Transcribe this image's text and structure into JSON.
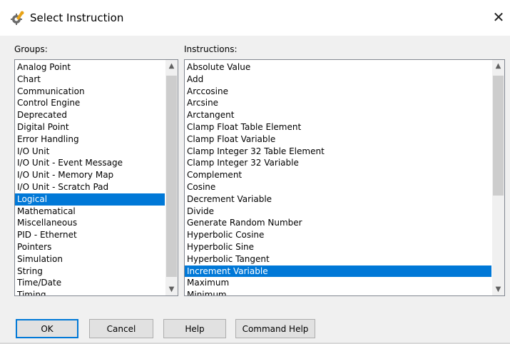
{
  "window": {
    "title": "Select Instruction",
    "close_glyph": "✕",
    "icon": "gear-wrench-icon"
  },
  "groups": {
    "label": "Groups:",
    "selected_index": 11,
    "items": [
      "Analog Point",
      "Chart",
      "Communication",
      "Control Engine",
      "Deprecated",
      "Digital Point",
      "Error Handling",
      "I/O Unit",
      "I/O Unit - Event Message",
      "I/O Unit - Memory Map",
      "I/O Unit - Scratch Pad",
      "Logical",
      "Mathematical",
      "Miscellaneous",
      "PID - Ethernet",
      "Pointers",
      "Simulation",
      "String",
      "Time/Date",
      "Timing"
    ]
  },
  "instructions": {
    "label": "Instructions:",
    "selected_index": 17,
    "items": [
      "Absolute Value",
      "Add",
      "Arccosine",
      "Arcsine",
      "Arctangent",
      "Clamp Float Table Element",
      "Clamp Float Variable",
      "Clamp Integer 32 Table Element",
      "Clamp Integer 32 Variable",
      "Complement",
      "Cosine",
      "Decrement Variable",
      "Divide",
      "Generate Random Number",
      "Hyperbolic Cosine",
      "Hyperbolic Sine",
      "Hyperbolic Tangent",
      "Increment Variable",
      "Maximum",
      "Minimum"
    ]
  },
  "buttons": {
    "ok": "OK",
    "cancel": "Cancel",
    "help": "Help",
    "command_help": "Command Help"
  },
  "colors": {
    "selection": "#0078d7",
    "default_button_border": "#0078d7"
  }
}
